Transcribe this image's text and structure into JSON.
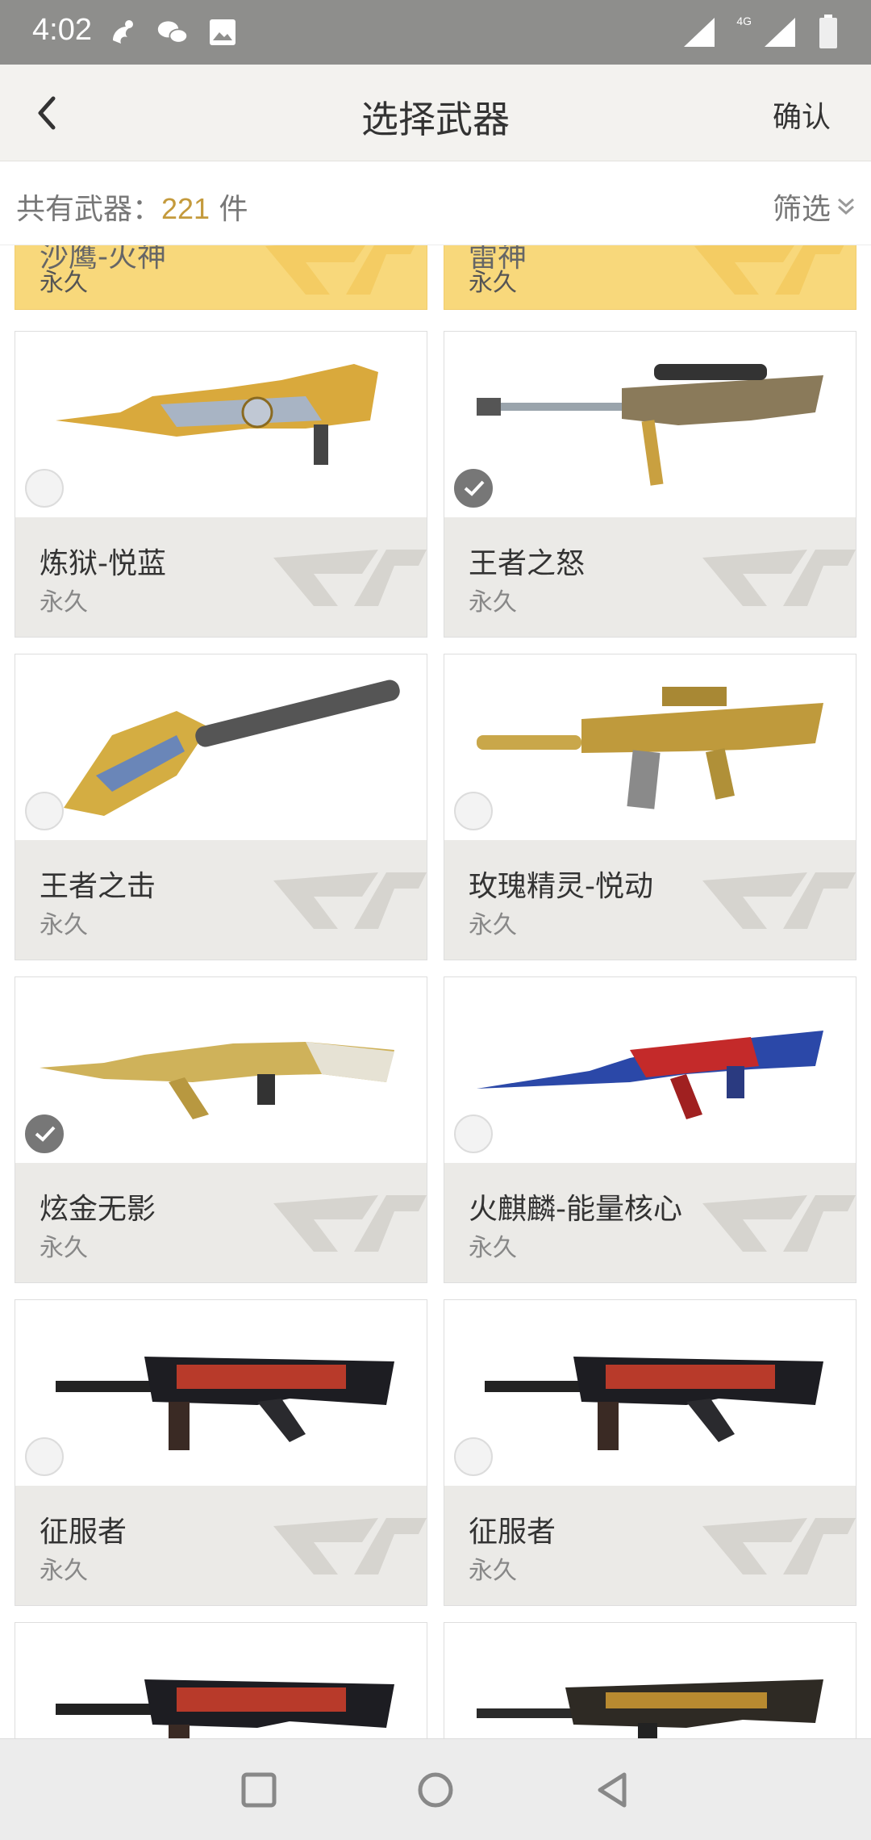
{
  "status_bar": {
    "time": "4:02",
    "network": "4G"
  },
  "header": {
    "title": "选择武器",
    "confirm_label": "确认",
    "back_icon": "chevron-left-icon"
  },
  "summary": {
    "prefix": "共有武器：",
    "count": "221",
    "suffix": " 件",
    "filter_label": "筛选"
  },
  "weapons": [
    {
      "name": "沙鹰-火神",
      "duration": "永久",
      "selected": false,
      "highlight": true
    },
    {
      "name": "雷神",
      "duration": "永久",
      "selected": false,
      "highlight": true
    },
    {
      "name": "炼狱-悦蓝",
      "duration": "永久",
      "selected": false
    },
    {
      "name": "王者之怒",
      "duration": "永久",
      "selected": true
    },
    {
      "name": "王者之击",
      "duration": "永久",
      "selected": false
    },
    {
      "name": "玫瑰精灵-悦动",
      "duration": "永久",
      "selected": false
    },
    {
      "name": "炫金无影",
      "duration": "永久",
      "selected": true
    },
    {
      "name": "火麒麟-能量核心",
      "duration": "永久",
      "selected": false
    },
    {
      "name": "征服者",
      "duration": "永久",
      "selected": false
    },
    {
      "name": "征服者",
      "duration": "永久",
      "selected": false
    }
  ],
  "colors": {
    "accent": "#c49a3c",
    "highlight": "#f8d87b",
    "status_bar": "#8e8e8c"
  }
}
